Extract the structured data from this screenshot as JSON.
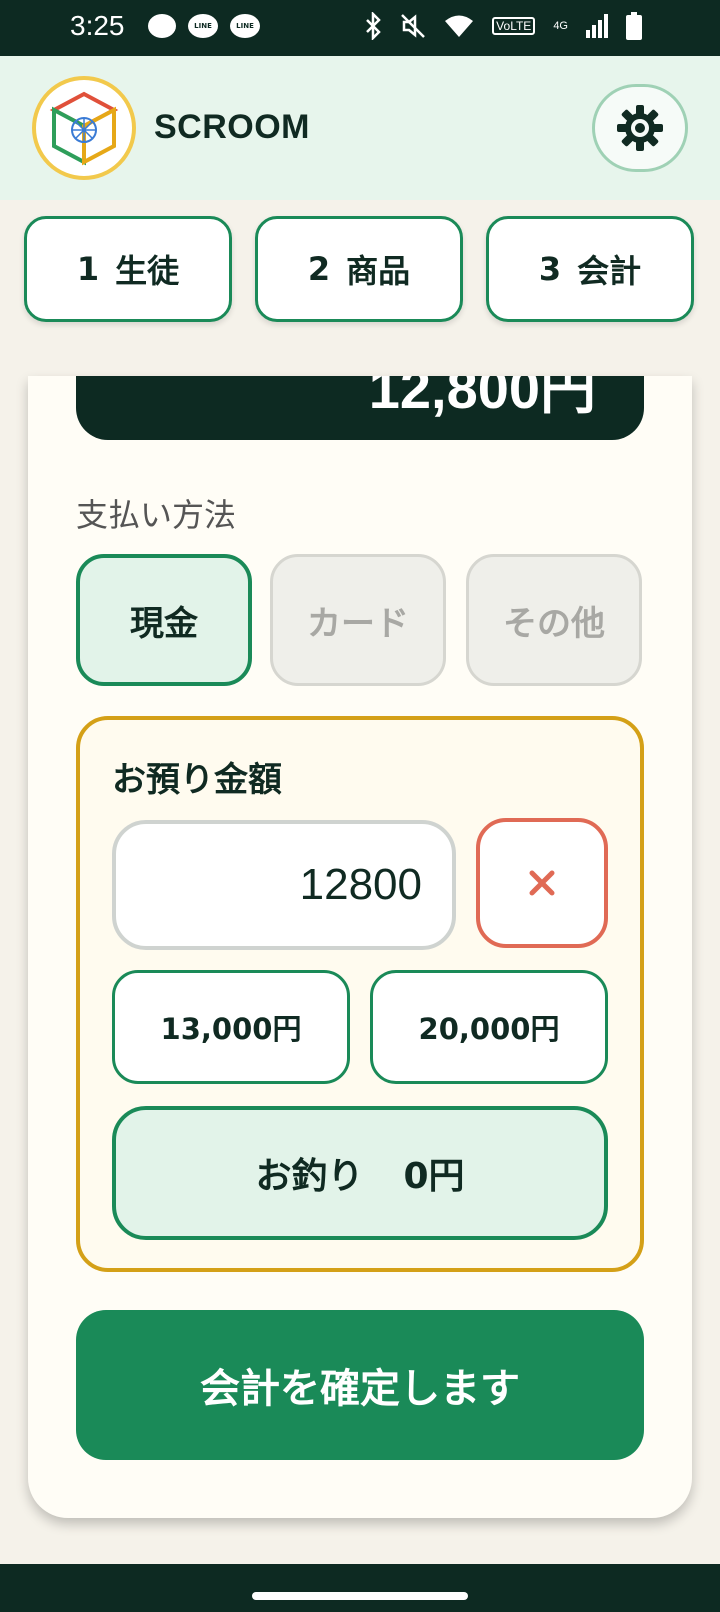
{
  "status_bar": {
    "time": "3:25",
    "line_label": "LINE",
    "network": "VoLTE",
    "network_gen": "4G"
  },
  "header": {
    "app_name": "SCROOM"
  },
  "tabs": [
    {
      "num": "1",
      "label": "生徒"
    },
    {
      "num": "2",
      "label": "商品"
    },
    {
      "num": "3",
      "label": "会計"
    }
  ],
  "checkout": {
    "total_partial": "12,800円",
    "payment_method_label": "支払い方法",
    "payment_methods": [
      {
        "label": "現金",
        "selected": true
      },
      {
        "label": "カード",
        "selected": false
      },
      {
        "label": "その他",
        "selected": false
      }
    ],
    "deposit": {
      "title": "お預り金額",
      "amount": "12800",
      "quick_amounts": [
        "13,000円",
        "20,000円"
      ],
      "change_label": "お釣り",
      "change_value": "0円"
    },
    "confirm_label": "会計を確定します"
  },
  "colors": {
    "accent_green": "#1a8a58",
    "dark_bg": "#0d2a22",
    "deposit_border": "#d4a017",
    "clear_red": "#e06a55"
  }
}
